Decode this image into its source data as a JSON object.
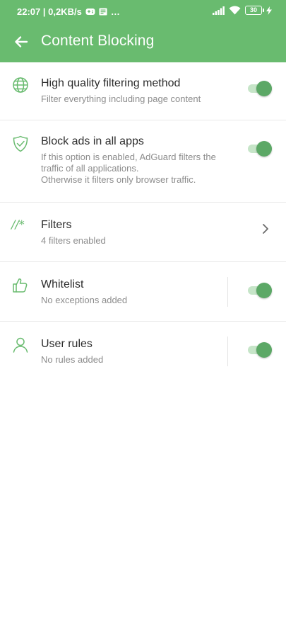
{
  "status_bar": {
    "time_speed": "22:07 | 0,2KB/s",
    "extra_icons": "…",
    "battery": "30"
  },
  "toolbar": {
    "title": "Content Blocking"
  },
  "settings": [
    {
      "icon": "globe-icon",
      "title": "High quality filtering method",
      "subtitle": "Filter everything including page content",
      "control": "switch",
      "enabled": true
    },
    {
      "icon": "shield-check-icon",
      "title": "Block ads in all apps",
      "subtitle": "If this option is enabled, AdGuard filters the traffic of all applications.\nOtherwise it filters only browser traffic.",
      "control": "switch",
      "enabled": true
    },
    {
      "icon": "filter-syntax-icon",
      "icon_text": "//*",
      "title": "Filters",
      "subtitle": "4 filters enabled",
      "control": "chevron"
    },
    {
      "icon": "thumbs-up-icon",
      "title": "Whitelist",
      "subtitle": "No exceptions added",
      "control": "switch",
      "enabled": true
    },
    {
      "icon": "user-icon",
      "title": "User rules",
      "subtitle": "No rules added",
      "control": "switch",
      "enabled": true
    }
  ],
  "colors": {
    "accent": "#69bb6f",
    "switch_on": "#5ca866",
    "switch_track": "#c6e5c8"
  }
}
